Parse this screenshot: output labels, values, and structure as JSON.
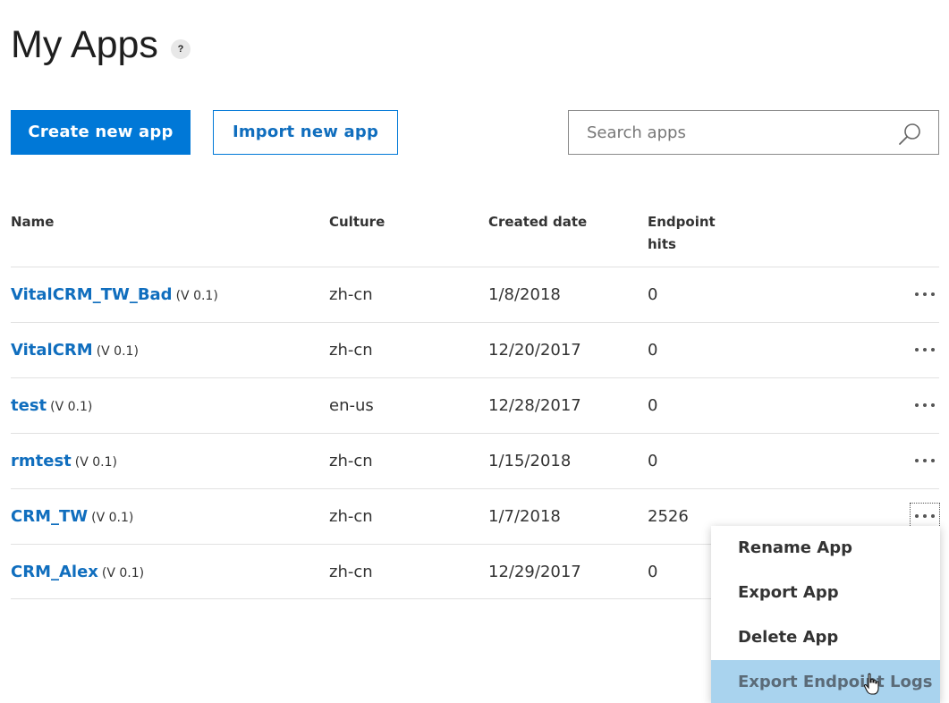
{
  "page": {
    "title": "My Apps",
    "help_icon": "?"
  },
  "toolbar": {
    "create_label": "Create new app",
    "import_label": "Import new app",
    "search_placeholder": "Search apps",
    "search_icon": "search-icon"
  },
  "table": {
    "headers": {
      "name": "Name",
      "culture": "Culture",
      "created": "Created date",
      "hits_line1": "Endpoint",
      "hits_line2": "hits"
    },
    "rows": [
      {
        "name": "VitalCRM_TW_Bad",
        "version": "(V 0.1)",
        "culture": "zh-cn",
        "created": "1/8/2018",
        "hits": "0"
      },
      {
        "name": "VitalCRM",
        "version": "(V 0.1)",
        "culture": "zh-cn",
        "created": "12/20/2017",
        "hits": "0"
      },
      {
        "name": "test",
        "version": "(V 0.1)",
        "culture": "en-us",
        "created": "12/28/2017",
        "hits": "0"
      },
      {
        "name": "rmtest",
        "version": "(V 0.1)",
        "culture": "zh-cn",
        "created": "1/15/2018",
        "hits": "0"
      },
      {
        "name": "CRM_TW",
        "version": "(V 0.1)",
        "culture": "zh-cn",
        "created": "1/7/2018",
        "hits": "2526"
      },
      {
        "name": "CRM_Alex",
        "version": "(V 0.1)",
        "culture": "zh-cn",
        "created": "12/29/2017",
        "hits": "0"
      }
    ]
  },
  "context_menu": {
    "items": [
      "Rename App",
      "Export App",
      "Delete App",
      "Export Endpoint Logs"
    ],
    "hovered_item": "Export Endpoint Logs"
  },
  "colors": {
    "accent": "#0078d7",
    "link": "#106ebe",
    "menu_hover": "#a9d3ee"
  }
}
